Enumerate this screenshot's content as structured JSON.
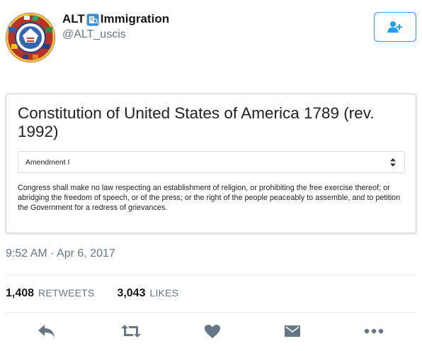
{
  "user": {
    "display_name_prefix": "ALT",
    "display_name_suffix": "Immigration",
    "name_emoji": "passport-control-emoji",
    "handle": "@ALT_uscis",
    "avatar": "seal-logo"
  },
  "follow_button": {
    "icon": "add-user-icon",
    "color": "#1da1f2"
  },
  "card": {
    "title": "Constitution of United States of America 1789 (rev. 1992)",
    "select_value": "Amendment I",
    "body": "Congress shall make no law respecting an establishment of religion, or prohibiting the free exercise thereof; or abridging the freedom of speech, or of the press; or the right of the people peaceably to assemble, and to petition the Government for a redress of grievances."
  },
  "timestamp": "9:52 AM · Apr 6, 2017",
  "stats": {
    "retweets_count": "1,408",
    "retweets_label": "RETWEETS",
    "likes_count": "3,043",
    "likes_label": "LIKES"
  },
  "actions": {
    "icons": [
      "reply-icon",
      "retweet-icon",
      "like-icon",
      "direct-message-icon",
      "more-icon"
    ],
    "icon_color": "#657786"
  }
}
